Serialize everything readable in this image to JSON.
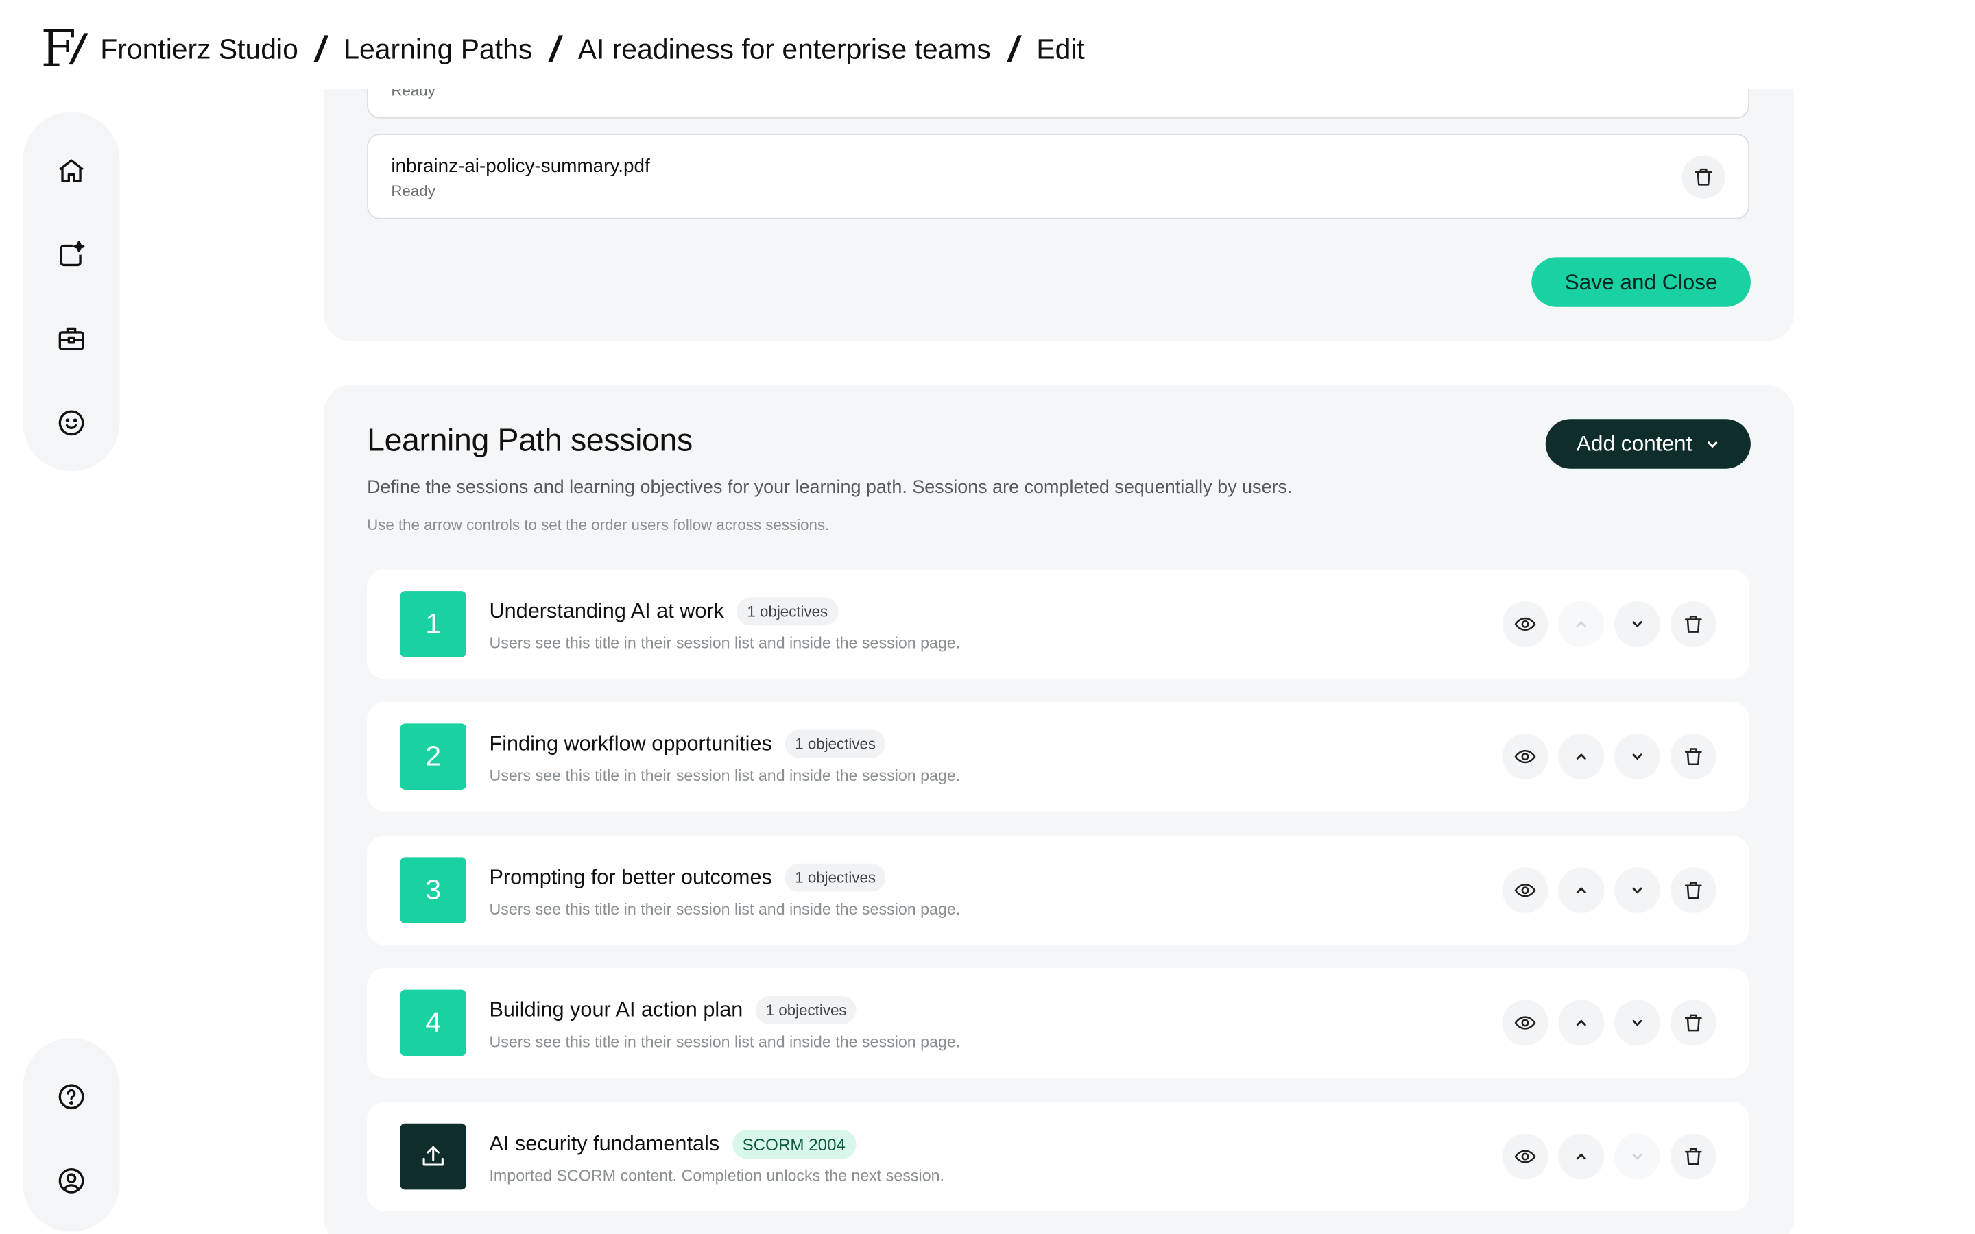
{
  "header": {
    "logo_text": "F",
    "crumbs": [
      "Frontierz Studio",
      "Learning Paths",
      "AI readiness for enterprise teams",
      "Edit"
    ]
  },
  "sidebar": {
    "top_icons": [
      "home-icon",
      "sparkle-card-icon",
      "briefcase-icon",
      "smiley-icon"
    ],
    "bottom_icons": [
      "help-icon",
      "user-circle-icon"
    ]
  },
  "files": {
    "items": [
      {
        "name": "",
        "status": "Ready"
      },
      {
        "name": "inbrainz-ai-policy-summary.pdf",
        "status": "Ready"
      }
    ],
    "save_label": "Save and Close"
  },
  "sessions": {
    "title": "Learning Path sessions",
    "description": "Define the sessions and learning objectives for your learning path. Sessions are completed sequentially by users.",
    "hint": "Use the arrow controls to set the order users follow across sessions.",
    "add_label": "Add content",
    "rows": [
      {
        "num": "1",
        "title": "Understanding AI at work",
        "badge": "1 objectives",
        "sub": "Users see this title in their session list and inside the session page."
      },
      {
        "num": "2",
        "title": "Finding workflow opportunities",
        "badge": "1 objectives",
        "sub": "Users see this title in their session list and inside the session page."
      },
      {
        "num": "3",
        "title": "Prompting for better outcomes",
        "badge": "1 objectives",
        "sub": "Users see this title in their session list and inside the session page."
      },
      {
        "num": "4",
        "title": "Building your AI action plan",
        "badge": "1 objectives",
        "sub": "Users see this title in their session list and inside the session page."
      },
      {
        "num": "",
        "title": "AI security fundamentals",
        "badge": "SCORM 2004",
        "sub": "Imported SCORM content. Completion unlocks the next session."
      }
    ]
  },
  "colors": {
    "accent": "#19d1a1",
    "dark": "#0f2e2b"
  }
}
